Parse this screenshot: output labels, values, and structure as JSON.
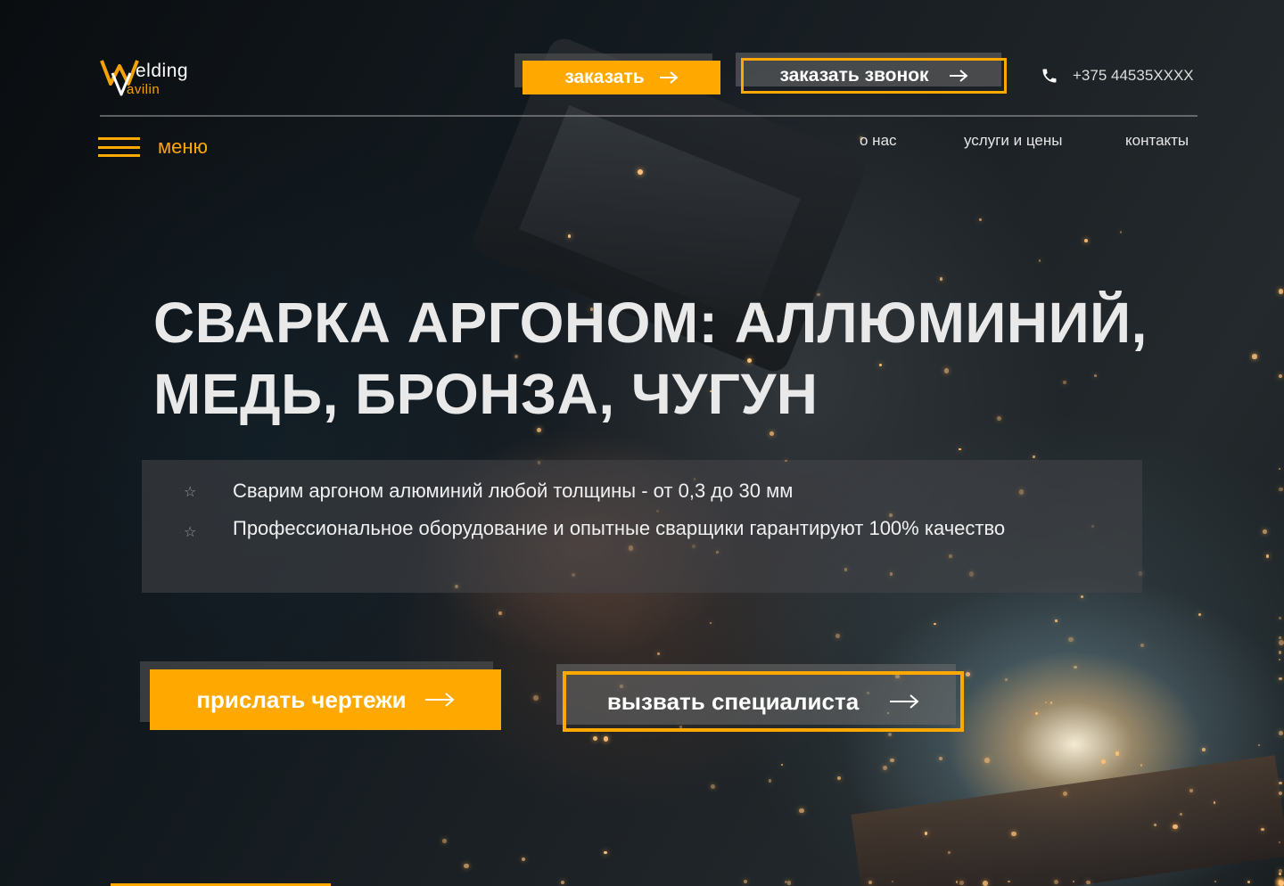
{
  "logo": {
    "line1": "elding",
    "line2": "avilin",
    "icon": "welding-vavilin-logo"
  },
  "header": {
    "order_label": "заказать",
    "call_label": "заказать звонок",
    "phone": "+375 44535XXXX",
    "phone_icon": "phone-icon",
    "menu_label": "меню",
    "nav": [
      "о нас",
      "услуги и цены",
      "контакты"
    ]
  },
  "hero": {
    "title_bold": "СВАРКА АРГОНОМ:",
    "title_rest_line1": " АЛЛЮМИНИЙ,",
    "title_line2": "МЕДЬ, БРОНЗА, ЧУГУН",
    "features": [
      "Сварим аргоном алюминий любой толщины - от 0,3 до 30 мм",
      "Профессиональное оборудование и опытные сварщики гарантируют 100% качество"
    ],
    "star_icon": "☆"
  },
  "cta": {
    "send_label": "прислать чертежи",
    "specialist_label": "вызвать специалиста"
  },
  "colors": {
    "accent": "#ffa800",
    "text": "#e9e9e9"
  }
}
